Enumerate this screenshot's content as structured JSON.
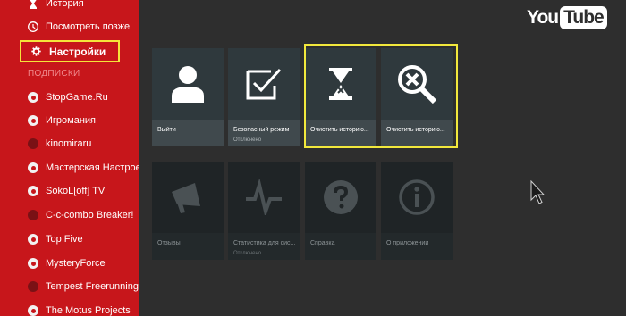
{
  "app": {
    "logo_you": "You",
    "logo_tube": "Tube"
  },
  "sidebar": {
    "items": [
      {
        "label": "История",
        "icon": "hourglass-icon"
      },
      {
        "label": "Посмотреть позже",
        "icon": "clock-icon"
      }
    ],
    "selected": {
      "label": "Настройки",
      "icon": "gear-icon"
    },
    "subscriptions_header": "ПОДПИСКИ",
    "channels": [
      {
        "label": "StopGame.Ru"
      },
      {
        "label": "Игромания"
      },
      {
        "label": "kinomiraru"
      },
      {
        "label": "Мастерская Настроен"
      },
      {
        "label": "SokoL[off] TV"
      },
      {
        "label": "C-c-combo Breaker!"
      },
      {
        "label": "Top Five"
      },
      {
        "label": "MysteryForce"
      },
      {
        "label": "Tempest Freerunning"
      },
      {
        "label": "The Motus Projects"
      }
    ]
  },
  "tiles_row1": [
    {
      "title": "Выйти",
      "subtitle": "",
      "icon": "person-icon"
    },
    {
      "title": "Безопасный режим",
      "subtitle": "Отключено",
      "icon": "checkbox-icon"
    },
    {
      "title": "Очистить историю...",
      "subtitle": "",
      "icon": "hourglass-icon"
    },
    {
      "title": "Очистить историю...",
      "subtitle": "",
      "icon": "search-clear-icon"
    }
  ],
  "tiles_row2": [
    {
      "title": "Отзывы",
      "subtitle": "",
      "icon": "megaphone-icon"
    },
    {
      "title": "Статистика для сис...",
      "subtitle": "Отключено",
      "icon": "pulse-icon"
    },
    {
      "title": "Справка",
      "subtitle": "",
      "icon": "help-icon"
    },
    {
      "title": "О приложении",
      "subtitle": "",
      "icon": "info-icon"
    }
  ],
  "colors": {
    "sidebar": "#c7161b",
    "highlight": "#f2e83c",
    "background": "#2e2e2e"
  }
}
